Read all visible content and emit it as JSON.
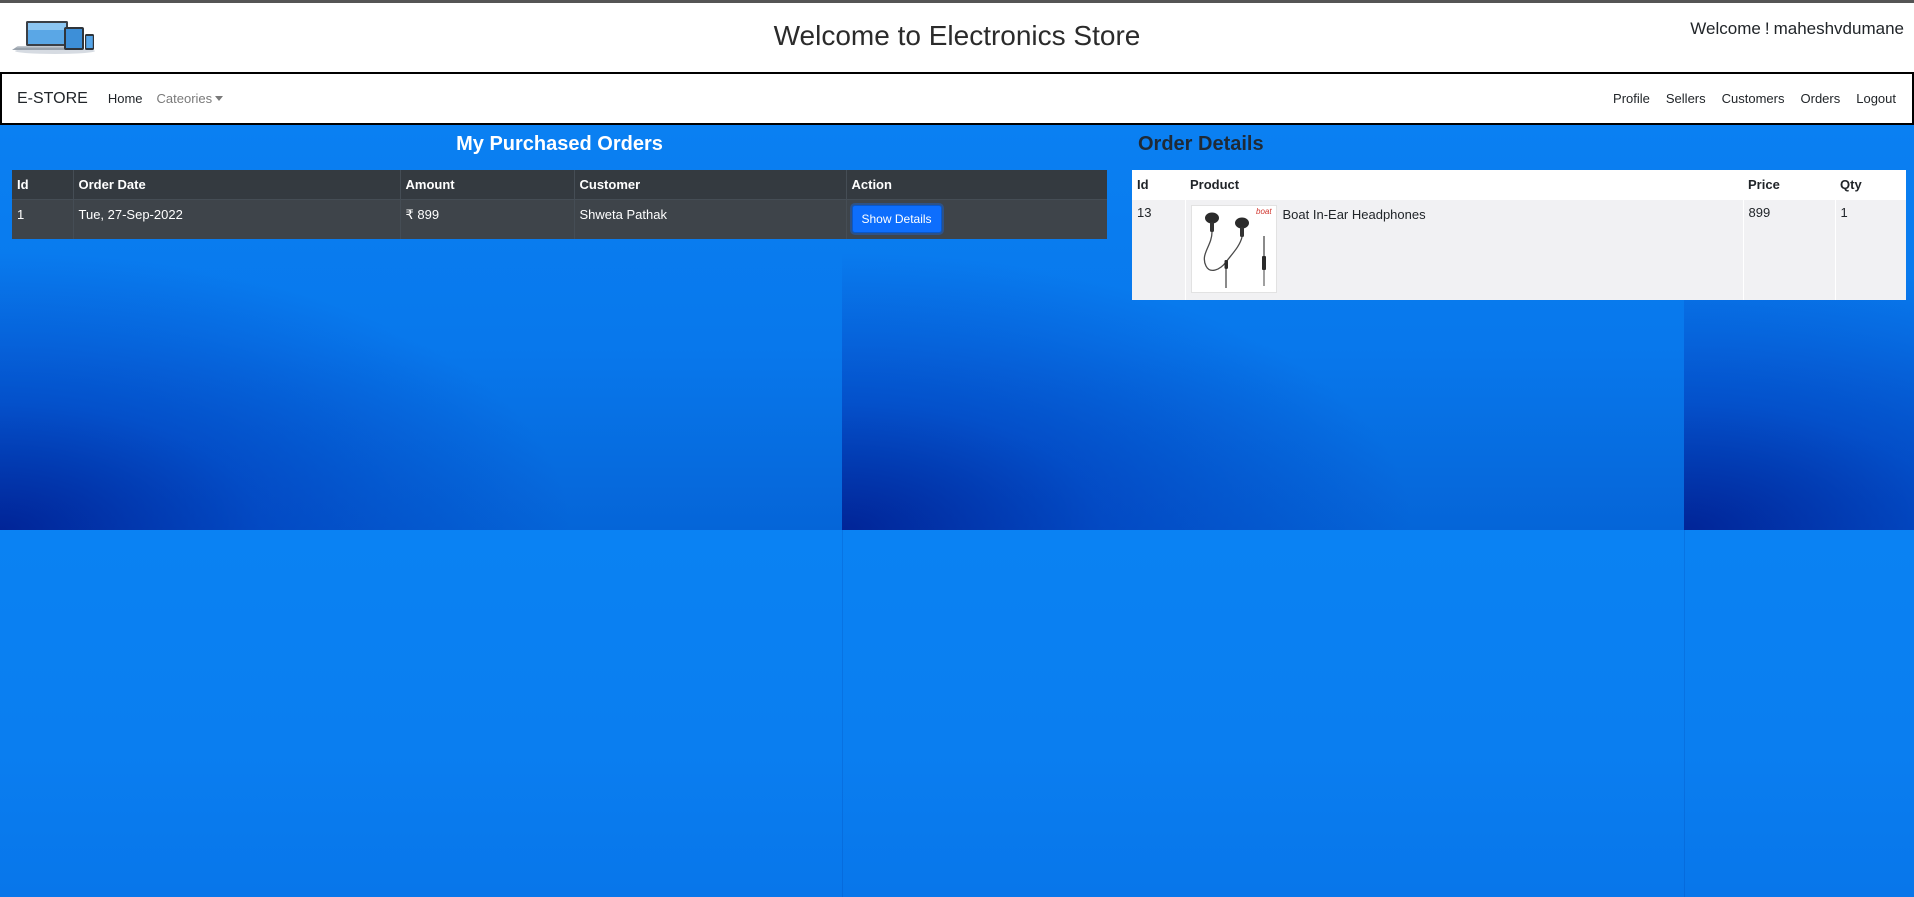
{
  "header": {
    "site_title": "Welcome to Electronics Store",
    "welcome_prefix": "Welcome",
    "welcome_sep": "!",
    "username": "maheshvdumane"
  },
  "navbar": {
    "brand": "E-STORE",
    "left_links": [
      {
        "label": "Home"
      },
      {
        "label": "Cateories"
      }
    ],
    "right_links": [
      {
        "label": "Profile"
      },
      {
        "label": "Sellers"
      },
      {
        "label": "Customers"
      },
      {
        "label": "Orders"
      },
      {
        "label": "Logout"
      }
    ]
  },
  "orders": {
    "title": "My Purchased Orders",
    "columns": [
      "Id",
      "Order Date",
      "Amount",
      "Customer",
      "Action"
    ],
    "rows": [
      {
        "id": "1",
        "order_date": "Tue, 27-Sep-2022",
        "amount": "₹ 899",
        "customer": "Shweta Pathak",
        "action_label": "Show Details"
      }
    ]
  },
  "order_details": {
    "title": "Order Details",
    "columns": [
      "Id",
      "Product",
      "Price",
      "Qty"
    ],
    "rows": [
      {
        "id": "13",
        "product_name": "Boat In-Ear Headphones",
        "product_image_brand": "boat",
        "price": "899",
        "qty": "1"
      }
    ]
  },
  "icons": {
    "logo": "laptop-tablet-logo",
    "caret": "caret-down-icon",
    "product_image": "earphones-image"
  },
  "colors": {
    "background": "#0a7ff0",
    "table_dark": "#343a40",
    "button_primary": "#0d6efd",
    "left_title": "#ffffff",
    "right_title": "#1f2a36"
  }
}
